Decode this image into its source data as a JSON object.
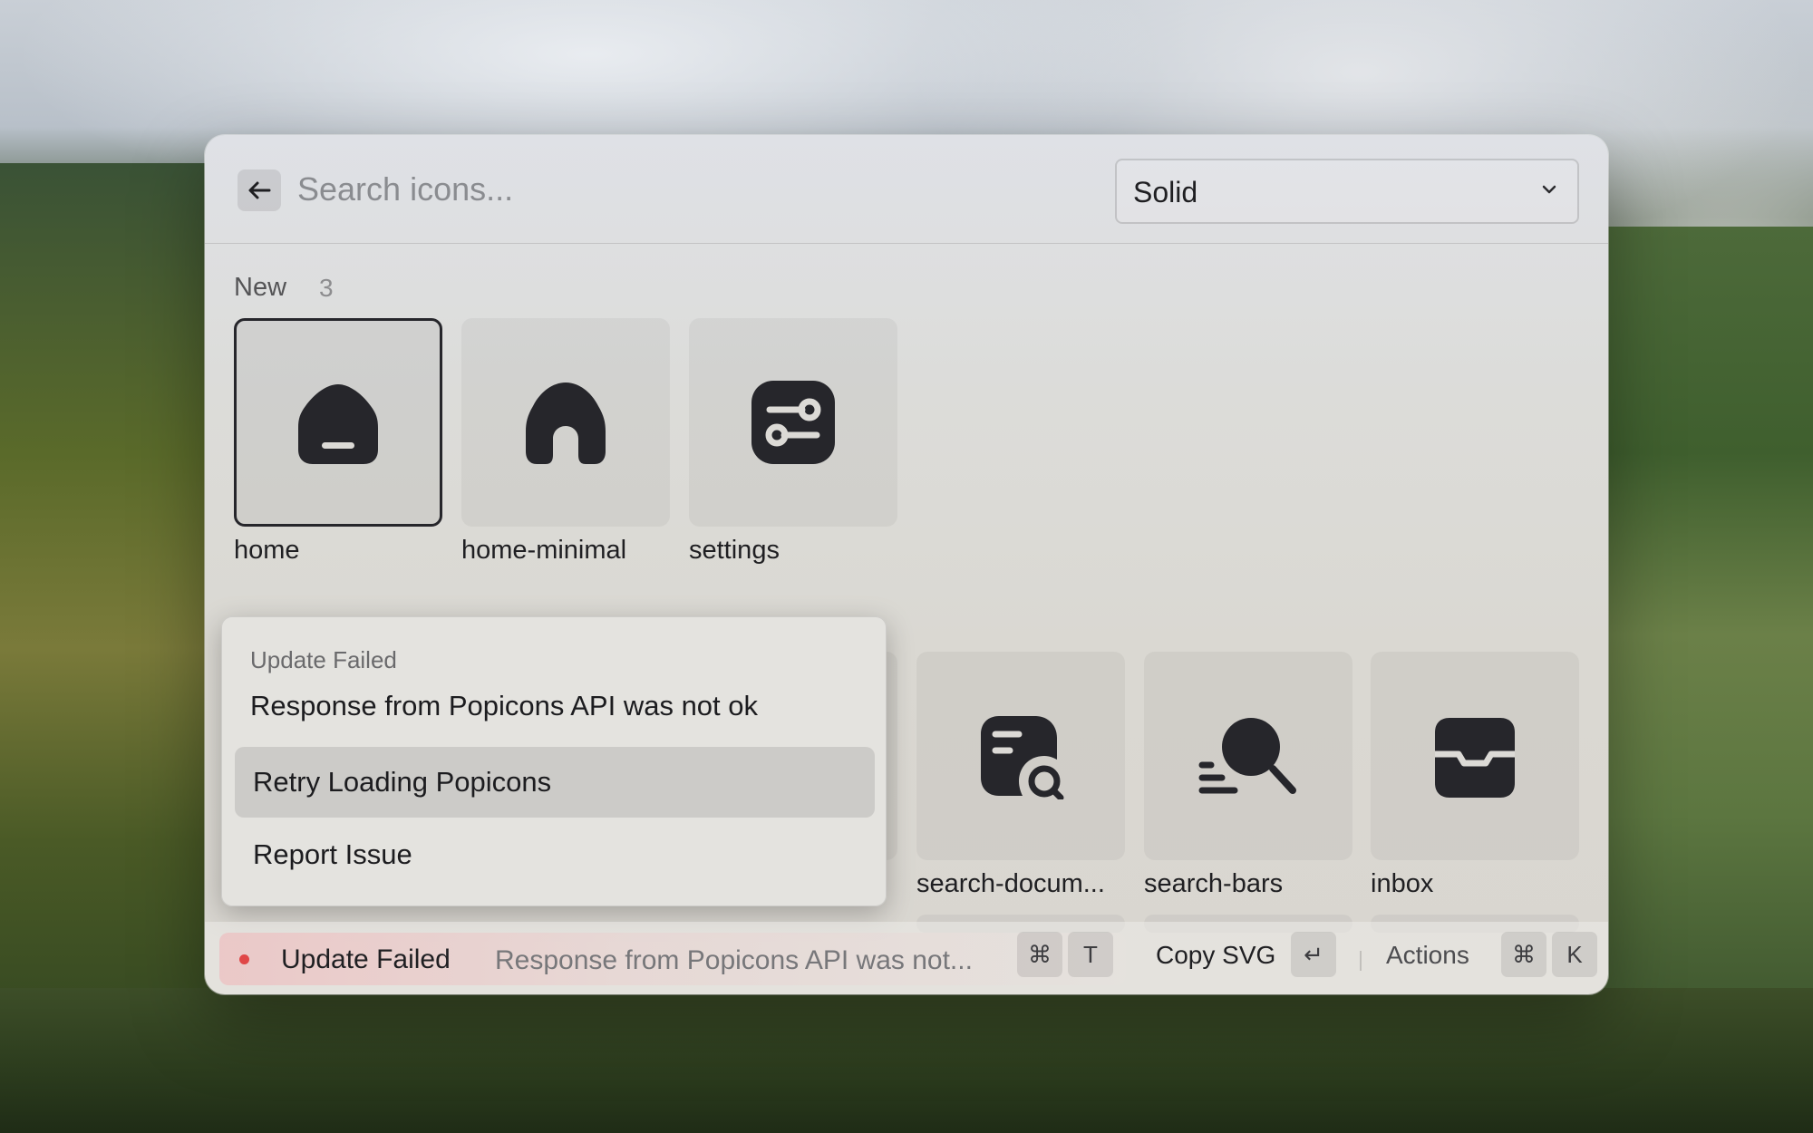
{
  "search": {
    "placeholder": "Search icons...",
    "style_selected": "Solid"
  },
  "sections": {
    "new": {
      "title": "New",
      "count": "3",
      "icons": [
        {
          "name": "home",
          "icon": "home-icon"
        },
        {
          "name": "home-minimal",
          "icon": "home-minimal-icon"
        },
        {
          "name": "settings",
          "icon": "settings-icon"
        }
      ]
    },
    "updated": {
      "icons": [
        {
          "name": "search-docum...",
          "icon": "search-document-icon"
        },
        {
          "name": "search-bars",
          "icon": "search-bars-icon"
        },
        {
          "name": "inbox",
          "icon": "inbox-icon"
        }
      ]
    }
  },
  "popup": {
    "title": "Update Failed",
    "message": "Response from Popicons API was not ok",
    "items": [
      "Retry Loading Popicons",
      "Report Issue"
    ]
  },
  "status_bar": {
    "title": "Update Failed",
    "message": "Response from Popicons API was not...",
    "toast_keys": [
      "⌘",
      "T"
    ],
    "primary_action": "Copy SVG",
    "primary_key": "↵",
    "actions_label": "Actions",
    "actions_keys": [
      "⌘",
      "K"
    ]
  },
  "colors": {
    "icon": "#26262b",
    "error_dot": "#e04747"
  }
}
